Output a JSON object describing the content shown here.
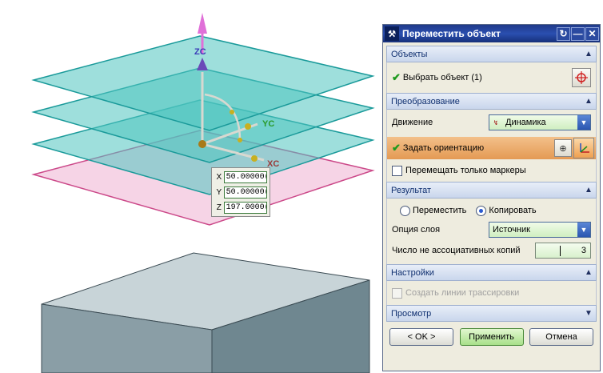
{
  "viewport": {
    "axis_labels": {
      "z": "ZC",
      "y": "YC",
      "x": "XC"
    },
    "coords": [
      {
        "axis": "X",
        "value": "50.00000("
      },
      {
        "axis": "Y",
        "value": "50.00000("
      },
      {
        "axis": "Z",
        "value": "197.0000("
      }
    ]
  },
  "dialog": {
    "title": "Переместить объект",
    "icons": {
      "app": "wrench-icon",
      "reset": "reset-icon",
      "minimize": "minimize-icon",
      "close": "close-icon"
    },
    "sections": {
      "objects": {
        "label": "Объекты",
        "select_label": "Выбрать объект (1)"
      },
      "transform": {
        "label": "Преобразование",
        "motion_label": "Движение",
        "motion_value": "Динамика",
        "orientation_label": "Задать ориентацию",
        "markers_only_label": "Перемещать только маркеры"
      },
      "result": {
        "label": "Результат",
        "move_label": "Переместить",
        "copy_label": "Копировать",
        "selected": "copy",
        "layer_option_label": "Опция слоя",
        "layer_option_value": "Источник",
        "copies_label": "Число не ассоциативных копий",
        "copies_value": "3"
      },
      "settings": {
        "label": "Настройки",
        "trace_lines_label": "Создать линии трассировки"
      },
      "preview": {
        "label": "Просмотр"
      }
    },
    "buttons": {
      "ok": "< OK >",
      "apply": "Применить",
      "cancel": "Отмена"
    }
  },
  "colors": {
    "plane_fill": "#4fc4c0",
    "plane_stroke": "#1a9a9a",
    "pink_plane": "#f3c6dd",
    "title_bar": "#1f3a8a",
    "apply_button": "#a8e08a",
    "orientation_row": "#e8a060"
  }
}
